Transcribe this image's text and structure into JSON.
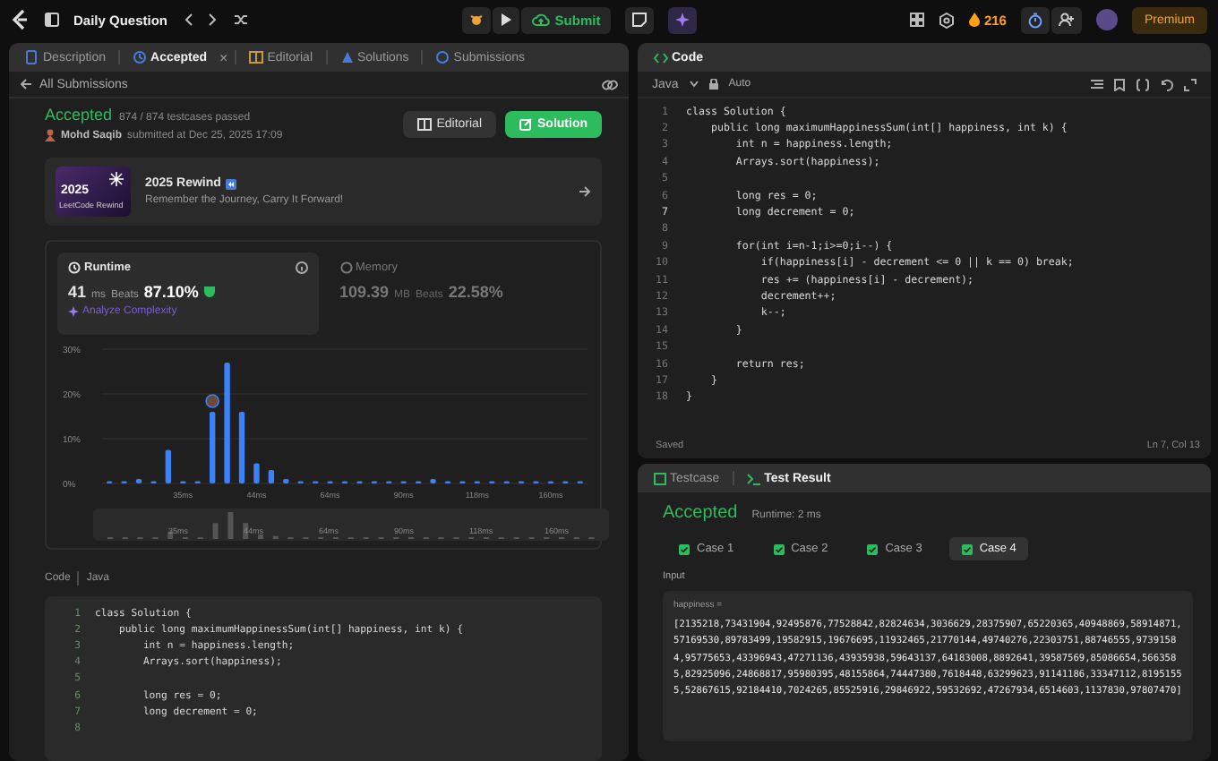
{
  "topbar": {
    "title": "Daily Question",
    "submit": "Submit",
    "streak": "216",
    "premium": "Premium"
  },
  "left_tabs": [
    {
      "label": "Description",
      "selected": false,
      "closable": false
    },
    {
      "label": "Accepted",
      "selected": true,
      "closable": true,
      "close": "×"
    },
    {
      "label": "Editorial",
      "selected": false,
      "closable": false
    },
    {
      "label": "Solutions",
      "selected": false,
      "closable": false
    },
    {
      "label": "Submissions",
      "selected": false,
      "closable": false
    }
  ],
  "back_link": "All Submissions",
  "submission": {
    "status": "Accepted",
    "testcases": "874 / 874 testcases passed",
    "user": "Mohd Saqib",
    "submitted": "submitted at Dec 25, 2025 17:09",
    "buttons": [
      {
        "label": "Editorial",
        "kind": "plain"
      },
      {
        "label": "Solution",
        "kind": "primary"
      }
    ]
  },
  "banner": {
    "title": "2025 Rewind",
    "subtitle": "Remember the Journey, Carry It Forward!",
    "thumb_year": "2025",
    "thumb_caption": "LeetCode Rewind"
  },
  "stats": [
    {
      "label": "Runtime",
      "value": "41",
      "unit": "ms",
      "beats_label": "Beats",
      "beats": "87.10%",
      "selected": true
    },
    {
      "label": "Memory",
      "value": "109.39",
      "unit": "MB",
      "beats_label": "Beats",
      "beats": "22.58%",
      "selected": false
    }
  ],
  "analyze": "Analyze Complexity",
  "chart_data": {
    "type": "bar",
    "categories": [
      null,
      null,
      null,
      null,
      null,
      "35ms",
      null,
      null,
      null,
      null,
      "44ms",
      null,
      null,
      null,
      null,
      "64ms",
      null,
      null,
      null,
      null,
      "90ms",
      null,
      null,
      null,
      null,
      "118ms",
      null,
      null,
      null,
      null,
      "160ms",
      null,
      null
    ],
    "series": [
      {
        "color": "#3b82f6",
        "values": [
          0.5,
          0.5,
          1,
          0.5,
          7.5,
          0.5,
          0.5,
          16,
          27,
          16,
          4.5,
          3,
          1,
          0.5,
          0.5,
          0.5,
          0.5,
          0.5,
          0.5,
          0.5,
          0.5,
          0.5,
          1,
          0.5,
          0.5,
          0.5,
          0.5,
          0.5,
          0.5,
          0.5,
          0.5,
          0.5,
          0.5
        ]
      }
    ],
    "ylim": [
      0,
      30
    ],
    "yticks": [
      {
        "value": 0,
        "label": "0%"
      },
      {
        "value": 10,
        "label": "10%"
      },
      {
        "value": 20,
        "label": "20%"
      },
      {
        "value": 30,
        "label": "30%"
      }
    ]
  },
  "navigator_labels": [
    "35ms",
    "44ms",
    "64ms",
    "90ms",
    "118ms",
    "160ms"
  ],
  "code_section": {
    "label": "Code",
    "language": "Java"
  },
  "submitted_code": [
    {
      "no": "1",
      "text": "class Solution {"
    },
    {
      "no": "2",
      "text": "    public long maximumHappinessSum(int[] happiness, int k) {"
    },
    {
      "no": "3",
      "text": "        int n = happiness.length;"
    },
    {
      "no": "4",
      "text": "        Arrays.sort(happiness);"
    },
    {
      "no": "5"
    },
    {
      "no": "6",
      "text": "        long res = 0;"
    },
    {
      "no": "7",
      "text": "        long decrement = 0;"
    },
    {
      "no": "8"
    }
  ],
  "editor": {
    "tab": "Code",
    "language": "Java",
    "mode": "Auto",
    "status": "Saved",
    "cursor": "Ln 7, Col 13",
    "lines": [
      {
        "no": "1",
        "text": "class Solution {",
        "active": false
      },
      {
        "no": "2",
        "text": "    public long maximumHappinessSum(int[] happiness, int k) {",
        "active": false
      },
      {
        "no": "3",
        "text": "        int n = happiness.length;",
        "active": false
      },
      {
        "no": "4",
        "text": "        Arrays.sort(happiness);",
        "active": false
      },
      {
        "no": "5",
        "active": false
      },
      {
        "no": "6",
        "text": "        long res = 0;",
        "active": false
      },
      {
        "no": "7",
        "text": "        long decrement = 0;",
        "active": true
      },
      {
        "no": "8",
        "active": false
      },
      {
        "no": "9",
        "text": "        for(int i=n-1;i>=0;i--) {",
        "active": false
      },
      {
        "no": "10",
        "text": "            if(happiness[i] - decrement <= 0 || k == 0) break;",
        "active": false
      },
      {
        "no": "11",
        "text": "            res += (happiness[i] - decrement);",
        "active": false
      },
      {
        "no": "12",
        "text": "            decrement++;",
        "active": false
      },
      {
        "no": "13",
        "text": "            k--;",
        "active": false
      },
      {
        "no": "14",
        "text": "        }",
        "active": false
      },
      {
        "no": "15",
        "active": false
      },
      {
        "no": "16",
        "text": "        return res;",
        "active": false
      },
      {
        "no": "17",
        "text": "    }",
        "active": false
      },
      {
        "no": "18",
        "text": "}",
        "active": false
      }
    ]
  },
  "result_tabs": [
    {
      "label": "Testcase",
      "selected": false
    },
    {
      "label": "Test Result",
      "selected": true
    }
  ],
  "result": {
    "status": "Accepted",
    "runtime": "Runtime: 2 ms",
    "input_label": "Input",
    "var_name": "happiness =",
    "value": "[2135218,73431904,92495876,77528842,82824634,3036629,28375907,65220365,40948869,58914871,57169530,89783499,19582915,19676695,11932465,21770144,49740276,22303751,88746555,97391584,95775653,43396943,47271136,43935938,59643137,64183008,8892641,39587569,85086654,5663585,82925096,24868817,95980395,48155864,74447380,7618448,63299623,91141186,33347112,81951555,52867615,92184410,7024265,85525916,29846922,59532692,47267934,6514603,1137830,97807470]"
  },
  "cases": [
    {
      "label": "Case 1",
      "selected": false
    },
    {
      "label": "Case 2",
      "selected": false
    },
    {
      "label": "Case 3",
      "selected": false
    },
    {
      "label": "Case 4",
      "selected": true
    }
  ]
}
